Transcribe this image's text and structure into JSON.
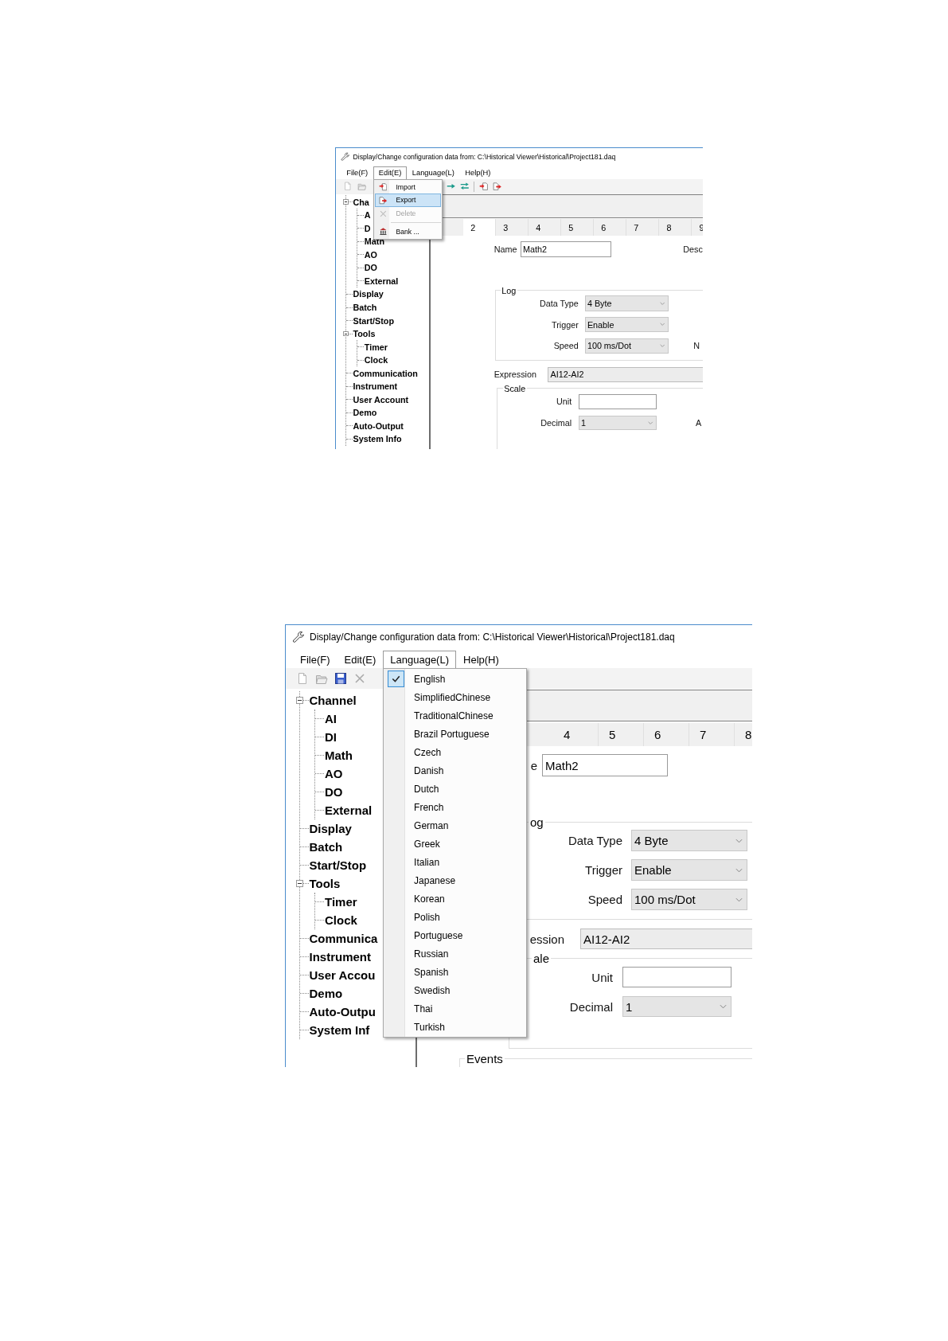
{
  "windows": [
    {
      "title": "Display/Change configuration data from: C:\\Historical Viewer\\Historical\\Project181.daq",
      "menu": [
        {
          "label": "File(F)",
          "selected": false
        },
        {
          "label": "Edit(E)",
          "selected": true
        },
        {
          "label": "Language(L)",
          "selected": false
        },
        {
          "label": "Help(H)",
          "selected": false
        }
      ],
      "dropdown": {
        "items": [
          {
            "kind": "import",
            "label": "Import",
            "selected": false,
            "disabled": false
          },
          {
            "kind": "export",
            "label": "Export",
            "selected": true,
            "disabled": false
          },
          {
            "kind": "delete",
            "label": "Delete",
            "selected": false,
            "disabled": true
          },
          {
            "kind": "separator"
          },
          {
            "kind": "bank",
            "label": "Bank ...",
            "selected": false,
            "disabled": false
          }
        ]
      },
      "tree": [
        {
          "label": "Cha",
          "expanded": true,
          "children": [
            {
              "label": "A"
            },
            {
              "label": "D"
            },
            {
              "label": "Math"
            },
            {
              "label": "AO"
            },
            {
              "label": "DO"
            },
            {
              "label": "External"
            }
          ]
        },
        {
          "label": "Display"
        },
        {
          "label": "Batch"
        },
        {
          "label": "Start/Stop"
        },
        {
          "label": "Tools",
          "expanded": true,
          "children": [
            {
              "label": "Timer"
            },
            {
              "label": "Clock"
            }
          ]
        },
        {
          "label": "Communication"
        },
        {
          "label": "Instrument"
        },
        {
          "label": "User Account"
        },
        {
          "label": "Demo"
        },
        {
          "label": "Auto-Output"
        },
        {
          "label": "System Info"
        }
      ],
      "tabs": [
        {
          "label": "2",
          "selected": true
        },
        {
          "label": "3",
          "selected": false
        },
        {
          "label": "4",
          "selected": false
        },
        {
          "label": "5",
          "selected": false
        },
        {
          "label": "6",
          "selected": false
        },
        {
          "label": "7",
          "selected": false
        },
        {
          "label": "8",
          "selected": false
        },
        {
          "label": "9",
          "selected": false
        }
      ],
      "name": {
        "label": "Name",
        "value": "Math2"
      },
      "description_label": "Desc",
      "log": {
        "title": "Log",
        "fields": [
          {
            "label": "Data Type",
            "value": "4 Byte"
          },
          {
            "label": "Trigger",
            "value": "Enable"
          },
          {
            "label": "Speed",
            "value": "100 ms/Dot",
            "side_label": "N"
          }
        ]
      },
      "expression": {
        "label": "Expression",
        "value": "AI12-AI2"
      },
      "scale": {
        "title": "Scale",
        "fields": [
          {
            "kind": "text",
            "label": "Unit"
          },
          {
            "kind": "select",
            "label": "Decimal",
            "value": "1",
            "side_label": "A"
          }
        ]
      }
    },
    {
      "title": "Display/Change configuration data from: C:\\Historical Viewer\\Historical\\Project181.daq",
      "menu": [
        {
          "label": "File(F)",
          "selected": false
        },
        {
          "label": "Edit(E)",
          "selected": false
        },
        {
          "label": "Language(L)",
          "selected": true
        },
        {
          "label": "Help(H)",
          "selected": false
        }
      ],
      "dropdown": {
        "items": [
          {
            "kind": "language",
            "label": "English",
            "checked": true
          },
          {
            "kind": "language",
            "label": "SimplifiedChinese",
            "checked": false
          },
          {
            "kind": "language",
            "label": "TraditionalChinese",
            "checked": false
          },
          {
            "kind": "language",
            "label": "Brazil Portuguese",
            "checked": false
          },
          {
            "kind": "language",
            "label": "Czech",
            "checked": false
          },
          {
            "kind": "language",
            "label": "Danish",
            "checked": false
          },
          {
            "kind": "language",
            "label": "Dutch",
            "checked": false
          },
          {
            "kind": "language",
            "label": "French",
            "checked": false
          },
          {
            "kind": "language",
            "label": "German",
            "checked": false
          },
          {
            "kind": "language",
            "label": "Greek",
            "checked": false
          },
          {
            "kind": "language",
            "label": "Italian",
            "checked": false
          },
          {
            "kind": "language",
            "label": "Japanese",
            "checked": false
          },
          {
            "kind": "language",
            "label": "Korean",
            "checked": false
          },
          {
            "kind": "language",
            "label": "Polish",
            "checked": false
          },
          {
            "kind": "language",
            "label": "Portuguese",
            "checked": false
          },
          {
            "kind": "language",
            "label": "Russian",
            "checked": false
          },
          {
            "kind": "language",
            "label": "Spanish",
            "checked": false
          },
          {
            "kind": "language",
            "label": "Swedish",
            "checked": false
          },
          {
            "kind": "language",
            "label": "Thai",
            "checked": false
          },
          {
            "kind": "language",
            "label": "Turkish",
            "checked": false
          }
        ]
      },
      "tree": [
        {
          "label": "Channel",
          "expanded": true,
          "children": [
            {
              "label": "AI"
            },
            {
              "label": "DI"
            },
            {
              "label": "Math"
            },
            {
              "label": "AO"
            },
            {
              "label": "DO"
            },
            {
              "label": "External"
            }
          ]
        },
        {
          "label": "Display"
        },
        {
          "label": "Batch"
        },
        {
          "label": "Start/Stop"
        },
        {
          "label": "Tools",
          "expanded": true,
          "children": [
            {
              "label": "Timer"
            },
            {
              "label": "Clock"
            }
          ]
        },
        {
          "label": "Communica"
        },
        {
          "label": "Instrument"
        },
        {
          "label": "User Accou"
        },
        {
          "label": "Demo"
        },
        {
          "label": "Auto-Outpu"
        },
        {
          "label": "System Inf"
        }
      ],
      "tabs": [
        {
          "label": "4",
          "selected": false
        },
        {
          "label": "5",
          "selected": false
        },
        {
          "label": "6",
          "selected": false
        },
        {
          "label": "7",
          "selected": false
        },
        {
          "label": "8",
          "selected": false
        }
      ],
      "name": {
        "label": "e",
        "value": "Math2"
      },
      "log": {
        "title": "og",
        "fields": [
          {
            "label": "Data Type",
            "value": "4 Byte"
          },
          {
            "label": "Trigger",
            "value": "Enable"
          },
          {
            "label": "Speed",
            "value": "100 ms/Dot"
          }
        ]
      },
      "expression": {
        "label": "ession",
        "value": "AI12-AI2"
      },
      "scale": {
        "title": "ale",
        "fields": [
          {
            "kind": "text",
            "label": "Unit"
          },
          {
            "kind": "select",
            "label": "Decimal",
            "value": "1"
          }
        ]
      },
      "events": {
        "title": "Events"
      }
    }
  ]
}
